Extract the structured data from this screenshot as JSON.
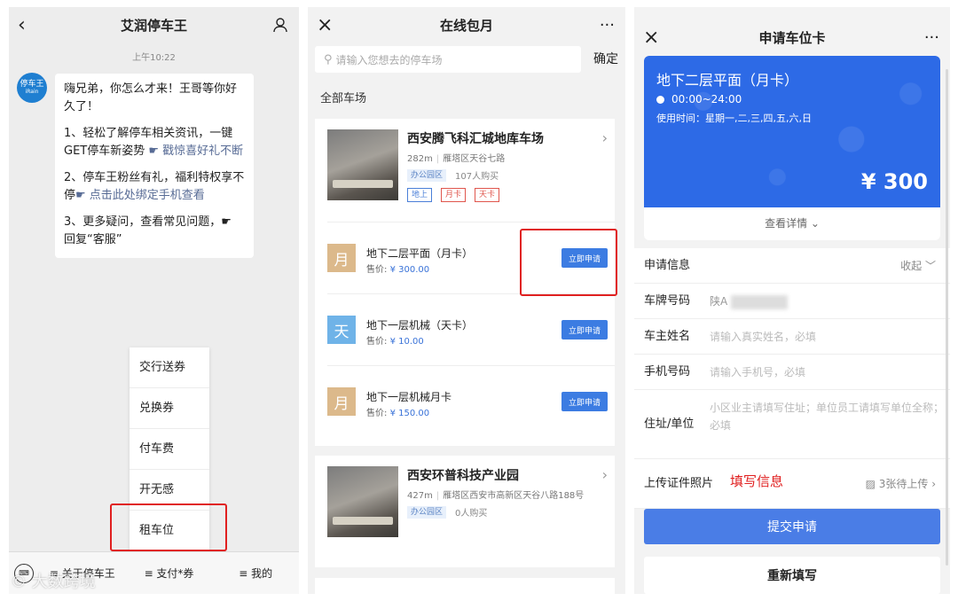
{
  "p1": {
    "title": "艾润停车王",
    "back": "‹",
    "user_icon": "user-icon",
    "time": "上午10:22",
    "logo": {
      "main": "停车王",
      "sub": "iRain"
    },
    "msg": {
      "greet": "嗨兄弟，你怎么才来！王哥等你好久了！",
      "item1_text": "1、轻松了解停车相关资讯，一键GET停车新姿势",
      "item1_link": "☛ 戳惊喜好礼不断",
      "item2_text": "2、停车王粉丝有礼，福利特权享不停",
      "item2_link": "☛ 点击此处绑定手机查看",
      "item3_text": "3、更多疑问，查看常见问题，☛ 回复“客服”"
    },
    "menu": [
      "交行送券",
      "兑换券",
      "付车费",
      "开无感",
      "租车位"
    ],
    "bottom": [
      "≡ 关于停车王",
      "≡ 支付*券",
      "≡ 我的"
    ],
    "watermark": "© 大数跨境"
  },
  "p2": {
    "title": "在线包月",
    "close": "×",
    "more": "···",
    "search_placeholder": "请输入您想去的停车场",
    "confirm": "确定",
    "section": "全部车场",
    "lot1": {
      "name": "西安腾飞科汇城地库车场",
      "distance": "282m",
      "address": "雁塔区天谷七路",
      "tag": "办公园区",
      "buyers": "107人购买",
      "badges": [
        "地上",
        "月卡",
        "天卡"
      ],
      "products": [
        {
          "icon": "月",
          "color": "#dcb98b",
          "name": "地下二层平面（月卡）",
          "price_label": "售价:",
          "price": "¥ 300.00",
          "btn": "立即申请"
        },
        {
          "icon": "天",
          "color": "#6fb3e8",
          "name": "地下一层机械（天卡）",
          "price_label": "售价:",
          "price": "¥ 10.00",
          "btn": "立即申请"
        },
        {
          "icon": "月",
          "color": "#dcb98b",
          "name": "地下一层机械月卡",
          "price_label": "售价:",
          "price": "¥ 150.00",
          "btn": "立即申请"
        }
      ]
    },
    "lot2": {
      "name": "西安环普科技产业园",
      "distance": "427m",
      "address": "雁塔区西安市高新区天谷八路188号",
      "tag": "办公园区",
      "buyers": "0人购买"
    }
  },
  "p3": {
    "title": "申请车位卡",
    "close": "×",
    "more": "···",
    "card": {
      "title": "地下二层平面（月卡）",
      "time": "00:00~24:00",
      "usage": "使用时间：星期一,二,三,四,五,六,日",
      "price": "¥ 300",
      "detail": "查看详情 ⌄"
    },
    "form": {
      "info_label": "申请信息",
      "collapse": "收起 ﹀",
      "plate_label": "车牌号码",
      "plate_value": "陕A",
      "owner_label": "车主姓名",
      "owner_placeholder": "请输入真实姓名，必填",
      "phone_label": "手机号码",
      "phone_placeholder": "请输入手机号，必填",
      "address_label": "住址/单位",
      "address_placeholder": "小区业主请填写住址；单位员工请填写单位全称；必填",
      "upload_label": "上传证件照片",
      "upload_hint": "▨ 3张待上传 ›",
      "fill_label": "填写信息"
    },
    "submit": "提交申请",
    "reset": "重新填写"
  }
}
